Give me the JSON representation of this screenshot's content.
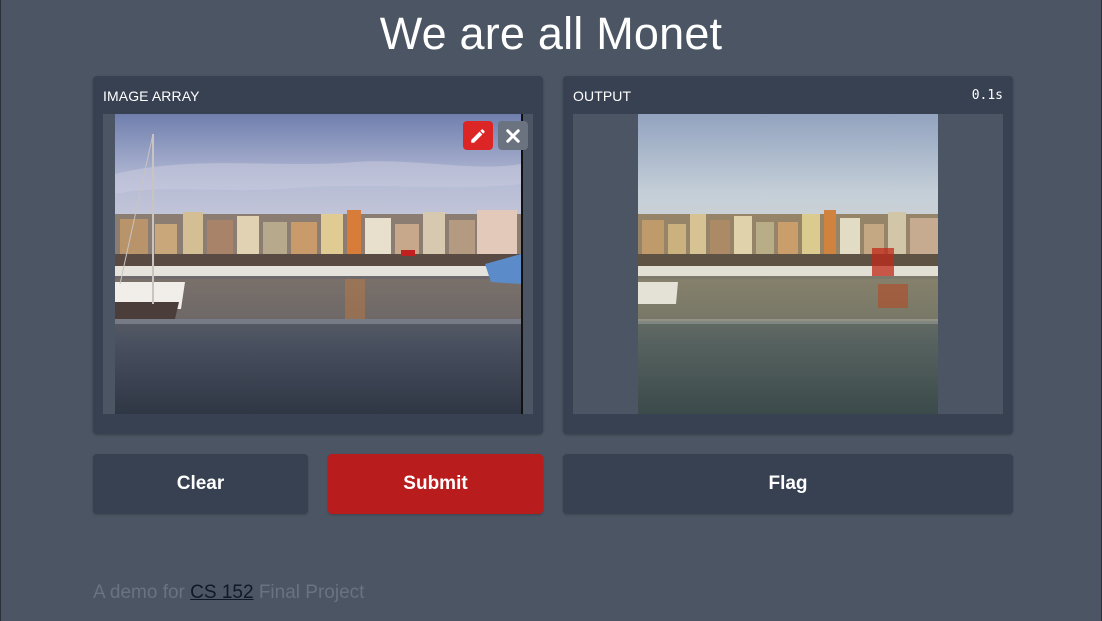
{
  "page": {
    "title": "We are all Monet"
  },
  "input_panel": {
    "label": "IMAGE ARRAY",
    "edit_icon": "pencil-icon",
    "clear_icon": "close-icon"
  },
  "output_panel": {
    "label": "OUTPUT",
    "timing": "0.1s"
  },
  "buttons": {
    "clear": "Clear",
    "submit": "Submit",
    "flag": "Flag"
  },
  "footer": {
    "prefix": "A demo for ",
    "link": "CS 152",
    "suffix": " Final Project"
  },
  "colors": {
    "background": "#4b5563",
    "panel": "#374151",
    "accent": "#b91c1c",
    "edit": "#dc2626"
  }
}
